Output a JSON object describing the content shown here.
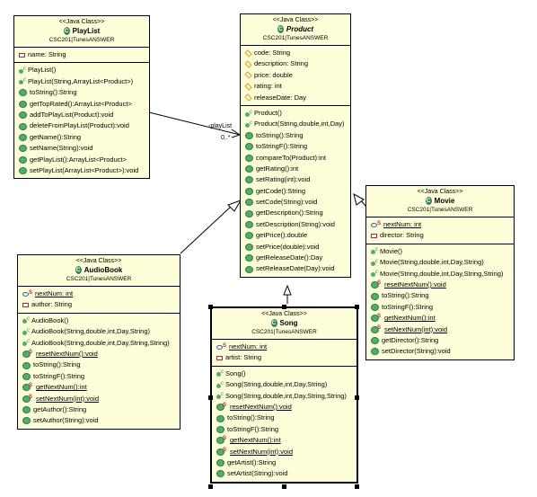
{
  "diagram": {
    "stereotype": "<<Java Class>>",
    "classes": {
      "playlist": {
        "name": "PlayList",
        "package": "CSC201|TunesANSWER",
        "fields": [
          {
            "vis": "private",
            "text": "name: String"
          }
        ],
        "methods": [
          {
            "kind": "ctor",
            "text": "PlayList()"
          },
          {
            "kind": "ctor",
            "text": "PlayList(String,ArrayList<Product>)"
          },
          {
            "kind": "public",
            "text": "toString():String"
          },
          {
            "kind": "public",
            "text": "getTopRated():ArrayList<Product>"
          },
          {
            "kind": "public",
            "text": "addToPlayList(Product):void"
          },
          {
            "kind": "public",
            "text": "deleteFromPlayList(Product):void"
          },
          {
            "kind": "public",
            "text": "getName():String"
          },
          {
            "kind": "public",
            "text": "setName(String):void"
          },
          {
            "kind": "public",
            "text": "getPlayList():ArrayList<Product>"
          },
          {
            "kind": "public",
            "text": "setPlayList(ArrayList<Product>):void"
          }
        ]
      },
      "product": {
        "name": "Product",
        "abstract": true,
        "package": "CSC201|TunesANSWER",
        "fields": [
          {
            "vis": "protected",
            "text": "code: String"
          },
          {
            "vis": "protected",
            "text": "description: String"
          },
          {
            "vis": "protected",
            "text": "price: double"
          },
          {
            "vis": "protected",
            "text": "rating: int"
          },
          {
            "vis": "protected",
            "text": "releaseDate: Day"
          }
        ],
        "methods": [
          {
            "kind": "ctor",
            "text": "Product()"
          },
          {
            "kind": "ctor",
            "text": "Product(String,double,int,Day)"
          },
          {
            "kind": "public",
            "text": "toString():String"
          },
          {
            "kind": "public",
            "text": "toStringF():String"
          },
          {
            "kind": "public",
            "text": "compareTo(Product):int"
          },
          {
            "kind": "public",
            "text": "getRating():int"
          },
          {
            "kind": "public",
            "text": "setRating(int):void"
          },
          {
            "kind": "public",
            "text": "getCode():String"
          },
          {
            "kind": "public",
            "text": "setCode(String):void"
          },
          {
            "kind": "public",
            "text": "getDescription():String"
          },
          {
            "kind": "public",
            "text": "setDescription(String):void"
          },
          {
            "kind": "public",
            "text": "getPrice():double"
          },
          {
            "kind": "public",
            "text": "setPrice(double):void"
          },
          {
            "kind": "public",
            "text": "getReleaseDate():Day"
          },
          {
            "kind": "public",
            "text": "setReleaseDate(Day):void"
          }
        ]
      },
      "movie": {
        "name": "Movie",
        "package": "CSC201|TunesANSWER",
        "fields": [
          {
            "vis": "static",
            "text": "nextNum: int"
          },
          {
            "vis": "private",
            "text": "director: String"
          }
        ],
        "methods": [
          {
            "kind": "ctor",
            "text": "Movie()"
          },
          {
            "kind": "ctor",
            "text": "Movie(String,double,int,Day,String)"
          },
          {
            "kind": "ctor",
            "text": "Movie(String,double,int,Day,String,String)"
          },
          {
            "kind": "static",
            "text": "resetNextNum():void"
          },
          {
            "kind": "public",
            "text": "toString():String"
          },
          {
            "kind": "public",
            "text": "toStringF():String"
          },
          {
            "kind": "static",
            "text": "getNextNum():int"
          },
          {
            "kind": "static",
            "text": "setNextNum(int):void"
          },
          {
            "kind": "public",
            "text": "getDirector():String"
          },
          {
            "kind": "public",
            "text": "setDirector(String):void"
          }
        ]
      },
      "audiobook": {
        "name": "AudioBook",
        "package": "CSC201|TunesANSWER",
        "fields": [
          {
            "vis": "static",
            "text": "nextNum: int"
          },
          {
            "vis": "private",
            "text": "author: String"
          }
        ],
        "methods": [
          {
            "kind": "ctor",
            "text": "AudioBook()"
          },
          {
            "kind": "ctor",
            "text": "AudioBook(String,double,int,Day,String)"
          },
          {
            "kind": "ctor",
            "text": "AudioBook(String,double,int,Day,String,String)"
          },
          {
            "kind": "static",
            "text": "resetNextNum():void"
          },
          {
            "kind": "public",
            "text": "toString():String"
          },
          {
            "kind": "public",
            "text": "toStringF():String"
          },
          {
            "kind": "static",
            "text": "getNextNum():int"
          },
          {
            "kind": "static",
            "text": "setNextNum(int):void"
          },
          {
            "kind": "public",
            "text": "getAuthor():String"
          },
          {
            "kind": "public",
            "text": "setAuthor(String):void"
          }
        ]
      },
      "song": {
        "name": "Song",
        "package": "CSC201|TunesANSWER",
        "fields": [
          {
            "vis": "static",
            "text": "nextNum: int"
          },
          {
            "vis": "private",
            "text": "artist: String"
          }
        ],
        "methods": [
          {
            "kind": "ctor",
            "text": "Song()"
          },
          {
            "kind": "ctor",
            "text": "Song(String,double,int,Day,String)"
          },
          {
            "kind": "ctor",
            "text": "Song(String,double,int,Day,String,String)"
          },
          {
            "kind": "static",
            "text": "resetNextNum():void"
          },
          {
            "kind": "public",
            "text": "toString():String"
          },
          {
            "kind": "public",
            "text": "toStringF():String"
          },
          {
            "kind": "static",
            "text": "getNextNum():int"
          },
          {
            "kind": "static",
            "text": "setNextNum(int):void"
          },
          {
            "kind": "public",
            "text": "getArtist():String"
          },
          {
            "kind": "public",
            "text": "setArtist(String):void"
          }
        ]
      }
    },
    "association": {
      "role": "-playList",
      "multiplicity": "0..*"
    }
  }
}
